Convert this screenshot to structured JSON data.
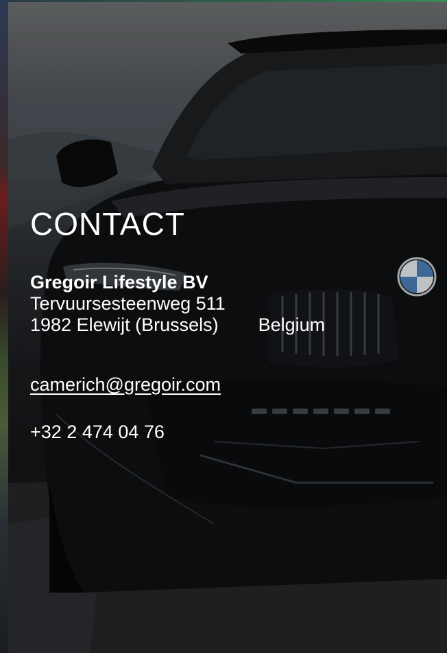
{
  "contact": {
    "title": "CONTACT",
    "company": "Gregoir Lifestyle BV",
    "street": "Tervuursesteenweg 511",
    "city": "1982 Elewijt (Brussels)",
    "country": "Belgium",
    "email": "camerich@gregoir.com",
    "phone": "+32 2 474 04 76"
  },
  "background": {
    "image": "black-car-front-photo"
  },
  "colors": {
    "text": "#ffffff",
    "accent_line": "#3c8a5a"
  }
}
